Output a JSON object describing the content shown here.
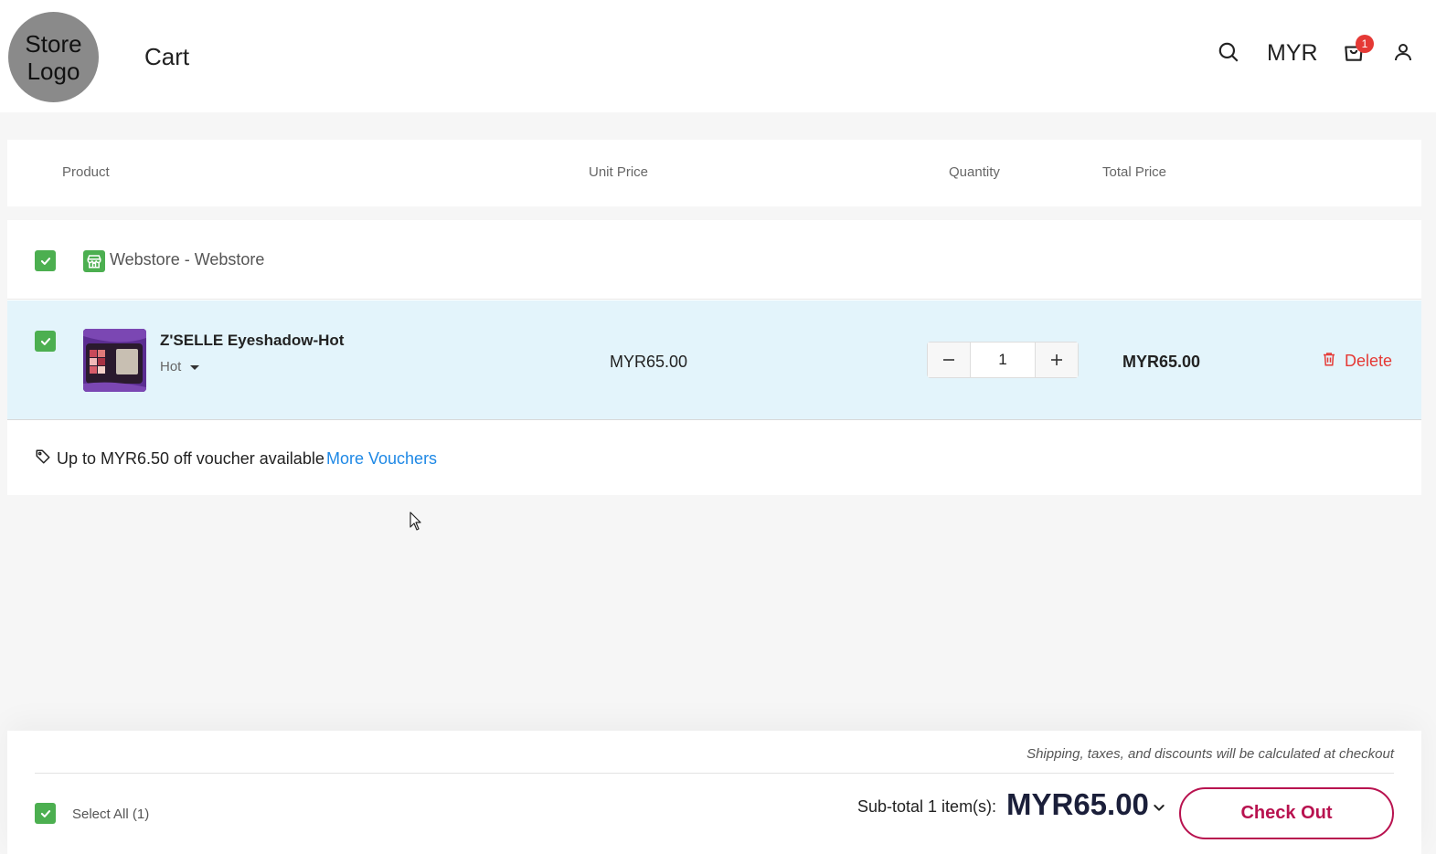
{
  "header": {
    "logo_text": "Store Logo",
    "title": "Cart",
    "currency": "MYR",
    "cart_count": "1",
    "icons": [
      "search-icon",
      "cart-icon",
      "user-icon"
    ]
  },
  "table_head": {
    "product": "Product",
    "unit_price": "Unit Price",
    "quantity": "Quantity",
    "total_price": "Total Price"
  },
  "store": {
    "name": "Webstore - Webstore",
    "checked": true
  },
  "item": {
    "name": "Z'SELLE Eyeshadow-Hot",
    "variant": "Hot",
    "unit_price": "MYR65.00",
    "quantity": "1",
    "total_price": "MYR65.00",
    "delete_label": "Delete",
    "checked": true
  },
  "voucher": {
    "text": "Up to MYR6.50 off voucher available",
    "link": "More Vouchers"
  },
  "footer": {
    "shipping_note": "Shipping, taxes, and discounts will be calculated at checkout",
    "select_all": "Select All (1)",
    "subtotal_label": "Sub-total 1 item(s):",
    "subtotal_amount": "MYR65.00",
    "checkout_label": "Check Out"
  },
  "colors": {
    "accent": "#b8124f",
    "check": "#4caf50",
    "delete": "#e53935",
    "link": "#1e88e5",
    "item_bg": "#e3f4fb"
  }
}
